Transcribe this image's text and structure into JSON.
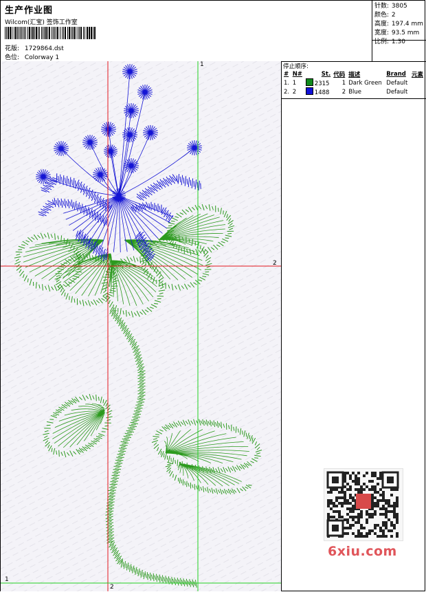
{
  "header": {
    "title": "生产作业图",
    "studio": "Wilcom(汇宝) 签饰工作室",
    "design_label": "花版:",
    "design_file": "1729864.dst",
    "color_label": "色位:",
    "colorway": "Colorway 1"
  },
  "stats": [
    {
      "label": "针数:",
      "value": "3805"
    },
    {
      "label": "颜色:",
      "value": "2"
    },
    {
      "label": "高度:",
      "value": "197.4 mm"
    },
    {
      "label": "宽度:",
      "value": "93.5 mm"
    },
    {
      "label": "比例:",
      "value": "1.30"
    }
  ],
  "stop_sequence": {
    "heading": "停止顺序:",
    "columns": [
      "#",
      "N#",
      "St.",
      "代码",
      "描述",
      "Brand",
      "元素"
    ],
    "rows": [
      {
        "index": "1.",
        "n": "1",
        "swatch": "#0f8a1c",
        "stitches": "2315",
        "code": "1",
        "description": "Dark Green",
        "brand": "Default",
        "element": ""
      },
      {
        "index": "2.",
        "n": "2",
        "swatch": "#1010d8",
        "stitches": "1488",
        "code": "2",
        "description": "Blue",
        "brand": "Default",
        "element": ""
      }
    ]
  },
  "guides": {
    "h_center_label": "2",
    "v_center_label": "2",
    "top_right_label": "1",
    "bottom_left_label": "1"
  },
  "thread_colors": {
    "green": "#2c9a1e",
    "blue": "#1515d4"
  },
  "watermark": "6xiu.com",
  "qr_stamp": "汉服图库"
}
